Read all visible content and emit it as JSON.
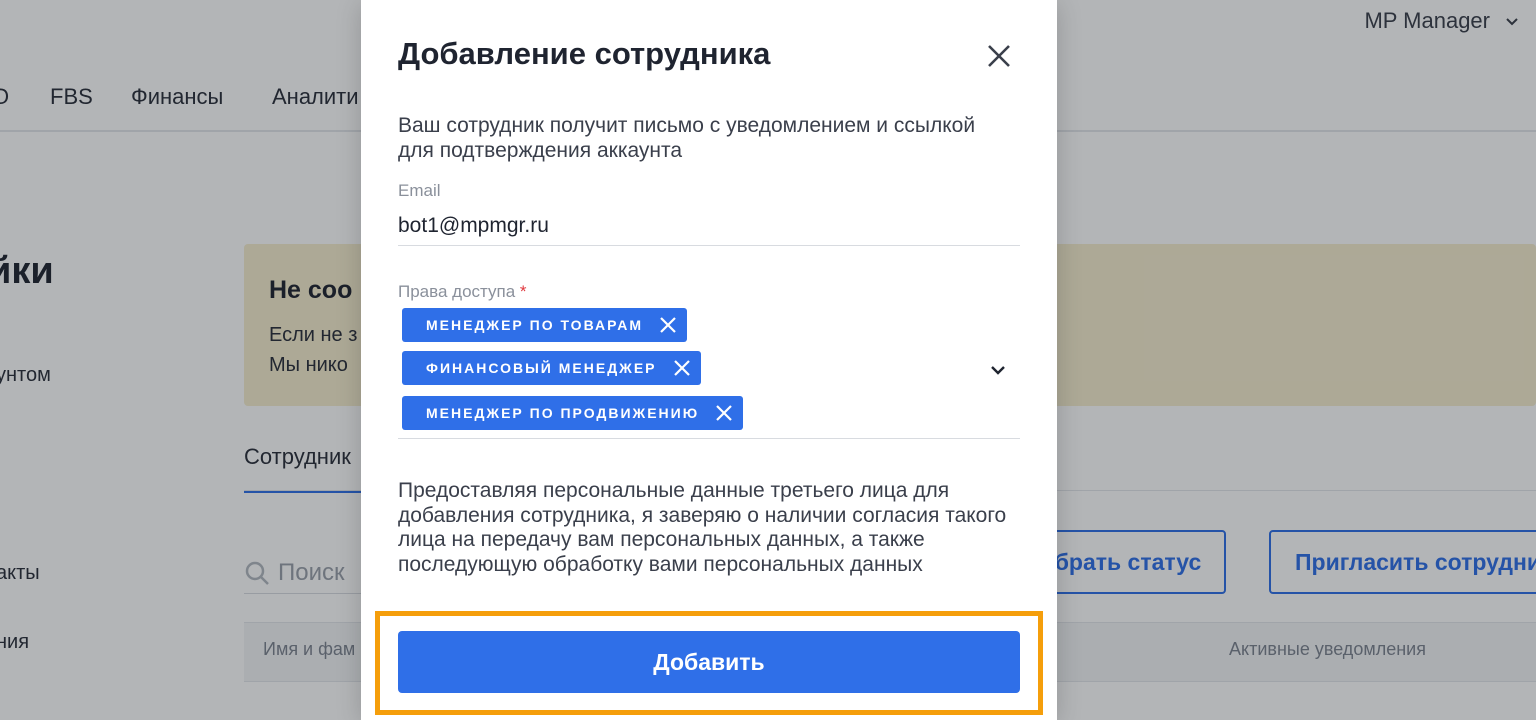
{
  "topbar": {
    "account_name": "MP Manager",
    "account_chevron": "chevron-down-icon"
  },
  "nav": {
    "items": [
      "O",
      "FBS",
      "Финансы",
      "Аналити"
    ]
  },
  "page": {
    "title_fragment": "йки",
    "side_links": [
      "унтом",
      ".",
      "акты",
      "ния"
    ]
  },
  "notice": {
    "title": "Не соо",
    "lines": [
      "Если не з",
      "Мы нико"
    ],
    "bg_color": "#f6edcf"
  },
  "tabs": {
    "employees_label": "Сотрудник"
  },
  "search": {
    "placeholder": "Поиск",
    "icon": "search-icon"
  },
  "actions": {
    "status_button_label": "брать статус",
    "invite_button_label": "Пригласить сотрудни"
  },
  "table": {
    "headers": [
      "Имя и фам",
      "Активные уведомления"
    ]
  },
  "modal": {
    "title": "Добавление сотрудника",
    "close_icon": "close-icon",
    "description": "Ваш сотрудник получит письмо с уведомлением и ссылкой для подтверждения аккаунта",
    "email_label": "Email",
    "email_value": "bot1@mpmgr.ru",
    "rights_label": "Права доступа",
    "required_mark": "*",
    "rights": [
      "МЕНЕДЖЕР ПО ТОВАРАМ",
      "ФИНАНСОВЫЙ МЕНЕДЖЕР",
      "МЕНЕДЖЕР ПО ПРОДВИЖЕНИЮ"
    ],
    "consent_text": "Предоставляя персональные данные третьего лица для добавления сотрудника, я заверяю о наличии согласия такого лица на передачу вам персональных данных, а также последующую обработку вами персональных данных",
    "submit_label": "Добавить"
  },
  "colors": {
    "accent": "#2f6fe8",
    "highlight": "#f59e0b",
    "required": "#e0383e"
  }
}
